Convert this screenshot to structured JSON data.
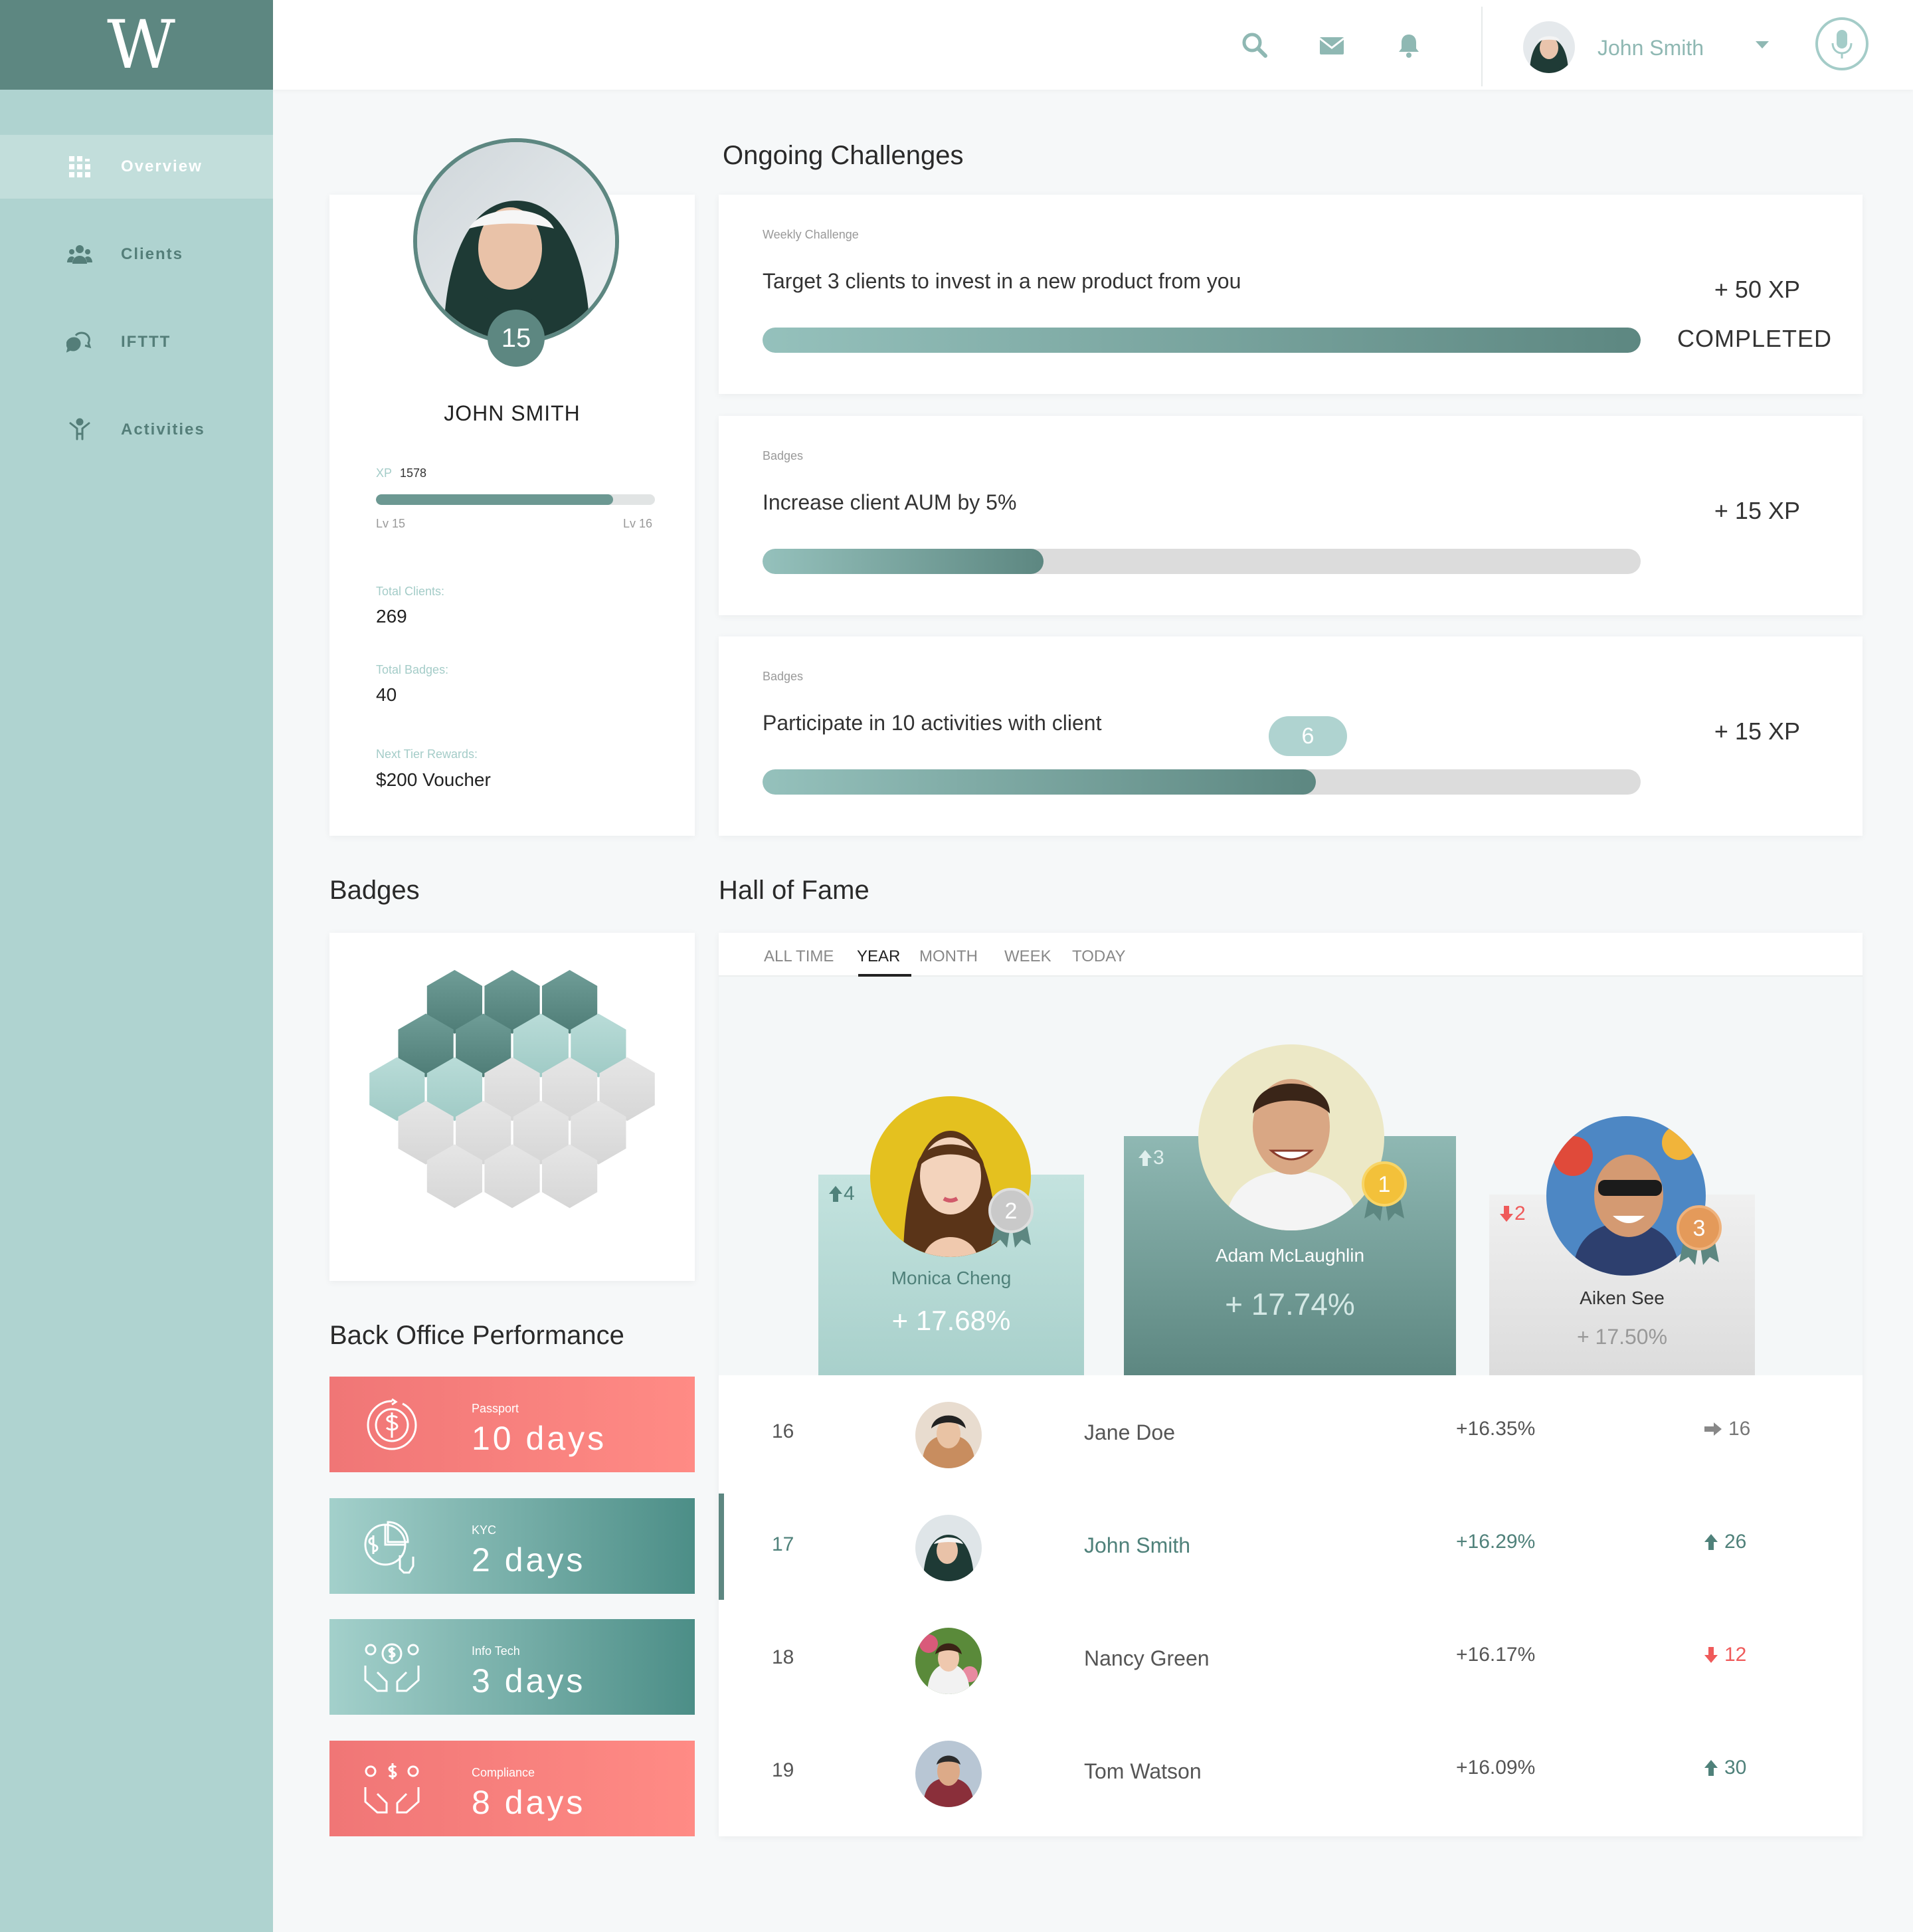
{
  "app": {
    "logo": "W"
  },
  "sidebar": {
    "items": [
      {
        "label": "Overview",
        "icon": "grid-icon",
        "active": true
      },
      {
        "label": "Clients",
        "icon": "users-icon",
        "active": false
      },
      {
        "label": "IFTTT",
        "icon": "chat-bubble-icon",
        "active": false
      },
      {
        "label": "Activities",
        "icon": "activity-figure-icon",
        "active": false
      }
    ]
  },
  "header": {
    "icons": [
      "search-icon",
      "mail-icon",
      "bell-icon",
      "microphone-icon"
    ],
    "user_name": "John Smith"
  },
  "profile": {
    "level": "15",
    "name": "JOHN SMITH",
    "xp_label": "XP",
    "xp_value": "1578",
    "xp_progress": 0.85,
    "lv_current": "Lv 15",
    "lv_next": "Lv 16",
    "stats": [
      {
        "label": "Total Clients:",
        "value": "269"
      },
      {
        "label": "Total Badges:",
        "value": "40"
      },
      {
        "label": "Next Tier Rewards:",
        "value": "$200 Voucher"
      }
    ]
  },
  "challenges": {
    "title": "Ongoing Challenges",
    "items": [
      {
        "type": "Weekly Challenge",
        "title": "Target 3 clients to invest in a new product from you",
        "xp": "+ 50 XP",
        "status": "COMPLETED",
        "progress": 1.0,
        "count": ""
      },
      {
        "type": "Badges",
        "title": "Increase client AUM by 5%",
        "xp": "+ 15 XP",
        "status": "",
        "progress": 0.32,
        "count": ""
      },
      {
        "type": "Badges",
        "title": "Participate in 10 activities with client",
        "xp": "+ 15 XP",
        "status": "",
        "progress": 0.63,
        "count": "6"
      }
    ]
  },
  "badges": {
    "title": "Badges",
    "earned_dark": 5,
    "earned_light": 4,
    "total": 17
  },
  "back_office": {
    "title": "Back Office Performance",
    "tiles": [
      {
        "label": "Passport",
        "value": "10 days",
        "color": "pink",
        "icon": "dollar-cycle-icon"
      },
      {
        "label": "KYC",
        "value": "2 days",
        "color": "teal",
        "icon": "pie-chart-hand-icon"
      },
      {
        "label": "Info Tech",
        "value": "3 days",
        "color": "teal",
        "icon": "hands-money-icon"
      },
      {
        "label": "Compliance",
        "value": "8 days",
        "color": "pink",
        "icon": "hands-money-icon"
      }
    ]
  },
  "hall_of_fame": {
    "title": "Hall of Fame",
    "tabs": [
      {
        "label": "ALL TIME",
        "active": false
      },
      {
        "label": "YEAR",
        "active": true
      },
      {
        "label": "MONTH",
        "active": false
      },
      {
        "label": "WEEK",
        "active": false
      },
      {
        "label": "TODAY",
        "active": false
      }
    ],
    "podium": [
      {
        "place": "1",
        "name": "Adam McLaughlin",
        "pct": "+ 17.74%",
        "move": "3",
        "dir": "up"
      },
      {
        "place": "2",
        "name": "Monica Cheng",
        "pct": "+ 17.68%",
        "move": "4",
        "dir": "up"
      },
      {
        "place": "3",
        "name": "Aiken See",
        "pct": "+ 17.50%",
        "move": "2",
        "dir": "down"
      }
    ],
    "rows": [
      {
        "rank": "16",
        "name": "Jane Doe",
        "pct": "+16.35%",
        "move": "16",
        "dir": "same",
        "me": false
      },
      {
        "rank": "17",
        "name": "John Smith",
        "pct": "+16.29%",
        "move": "26",
        "dir": "up",
        "me": true
      },
      {
        "rank": "18",
        "name": "Nancy Green",
        "pct": "+16.17%",
        "move": "12",
        "dir": "down",
        "me": false
      },
      {
        "rank": "19",
        "name": "Tom Watson",
        "pct": "+16.09%",
        "move": "30",
        "dir": "up",
        "me": false
      }
    ]
  },
  "colors": {
    "primary": "#5d8781",
    "sidebar": "#afd3d0",
    "pink": "#ff8b85",
    "up": "#4f817a",
    "down": "#ef5a5a"
  }
}
